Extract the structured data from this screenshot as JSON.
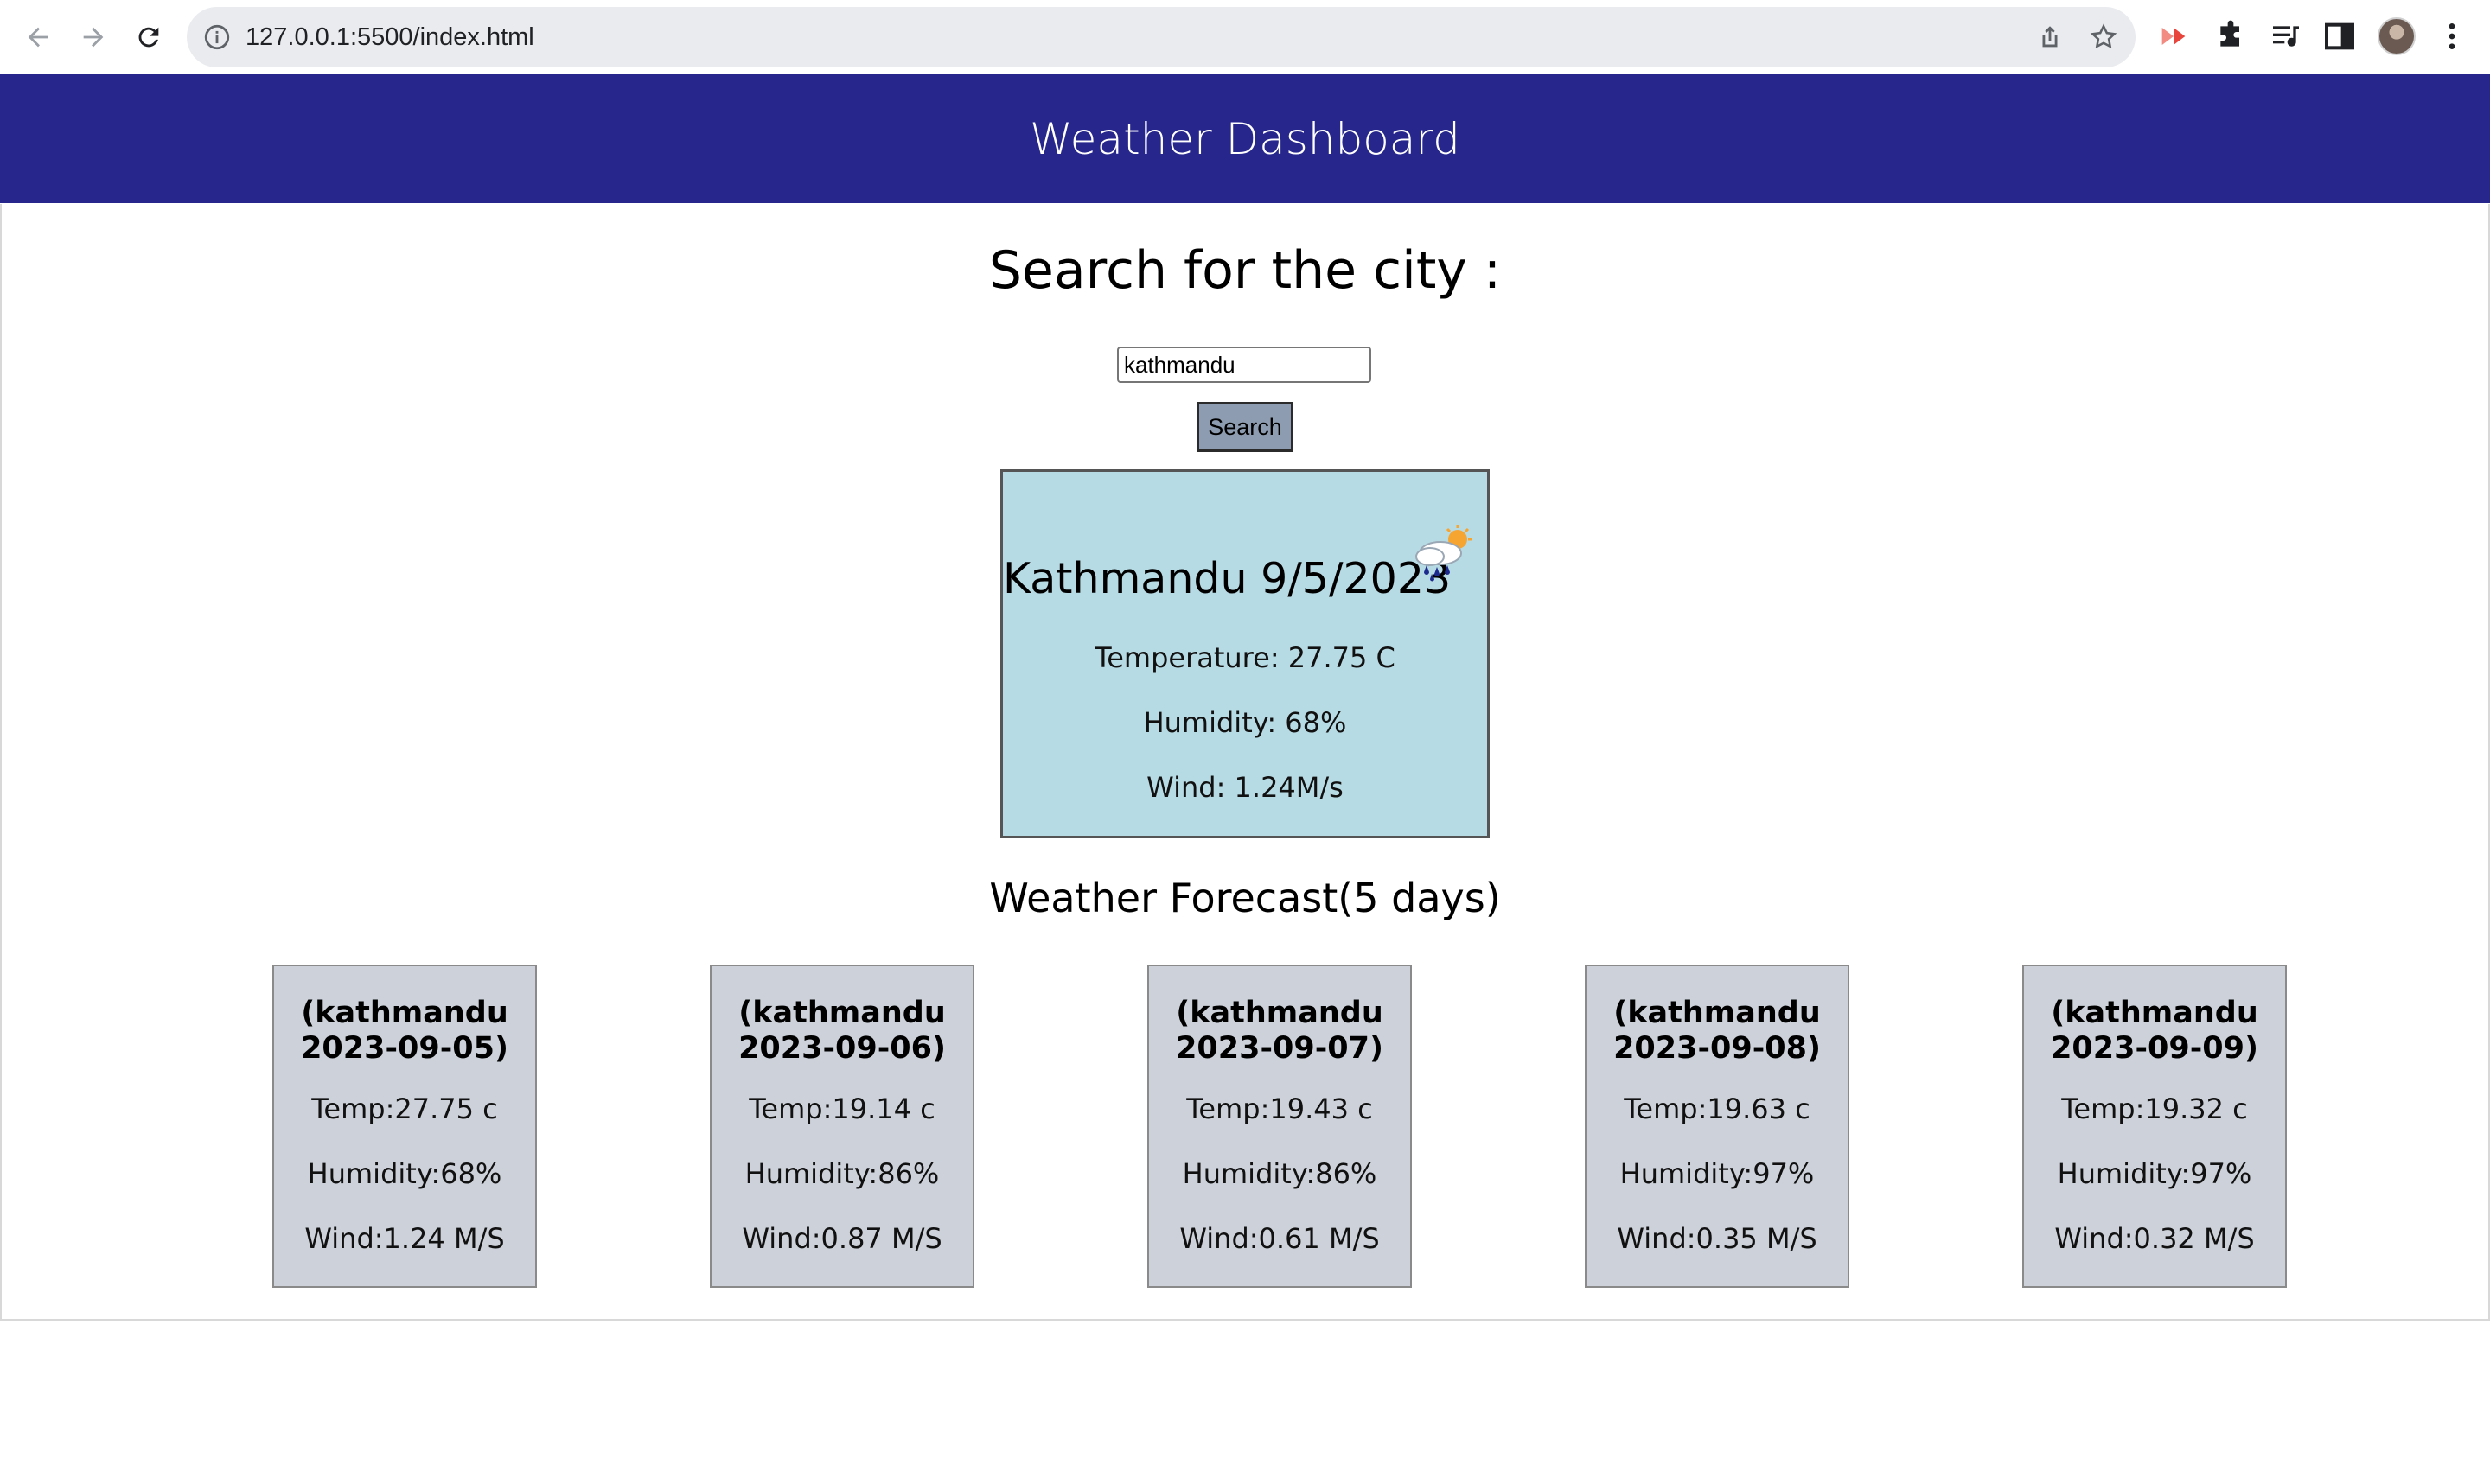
{
  "browser": {
    "url": "127.0.0.1:5500/index.html",
    "icons": [
      "back-arrow-icon",
      "forward-arrow-icon",
      "reload-icon",
      "info-icon",
      "share-icon",
      "bookmark-star-icon",
      "extension-red-icon",
      "puzzle-extensions-icon",
      "media-queue-icon",
      "side-panel-icon",
      "profile-avatar",
      "more-menu-icon"
    ]
  },
  "header": {
    "title": "Weather Dashboard"
  },
  "search": {
    "heading": "Search for the city :",
    "input_value": "kathmandu",
    "button_label": "Search"
  },
  "current": {
    "title": "Kathmandu 9/5/2023",
    "icon": "rain-cloud-sun-icon",
    "temperature": "Temperature: 27.75 C",
    "humidity": "Humidity: 68%",
    "wind": "Wind: 1.24M/s",
    "background": "#b7dbe4"
  },
  "forecast": {
    "heading": "Weather Forecast(5 days)",
    "days": [
      {
        "title_line1": "(kathmandu",
        "title_line2": "2023-09-05)",
        "temp": "Temp:27.75 c",
        "humidity": "Humidity:68%",
        "wind": "Wind:1.24 M/S"
      },
      {
        "title_line1": "(kathmandu",
        "title_line2": "2023-09-06)",
        "temp": "Temp:19.14 c",
        "humidity": "Humidity:86%",
        "wind": "Wind:0.87 M/S"
      },
      {
        "title_line1": "(kathmandu",
        "title_line2": "2023-09-07)",
        "temp": "Temp:19.43 c",
        "humidity": "Humidity:86%",
        "wind": "Wind:0.61 M/S"
      },
      {
        "title_line1": "(kathmandu",
        "title_line2": "2023-09-08)",
        "temp": "Temp:19.63 c",
        "humidity": "Humidity:97%",
        "wind": "Wind:0.35 M/S"
      },
      {
        "title_line1": "(kathmandu",
        "title_line2": "2023-09-09)",
        "temp": "Temp:19.32 c",
        "humidity": "Humidity:97%",
        "wind": "Wind:0.32 M/S"
      }
    ]
  },
  "colors": {
    "header_bg": "#26268c",
    "forecast_card_bg": "#cdd2da",
    "search_button_bg": "#8d9cb0"
  }
}
